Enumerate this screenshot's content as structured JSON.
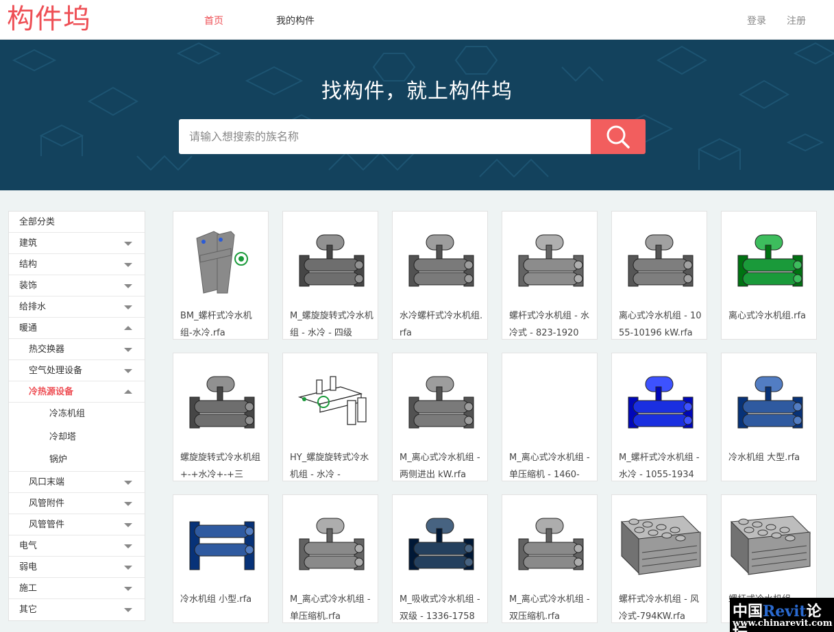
{
  "header": {
    "logo": "构件坞",
    "nav": [
      {
        "label": "首页",
        "active": true
      },
      {
        "label": "我的构件",
        "active": false
      }
    ],
    "login": "登录",
    "register": "注册"
  },
  "banner": {
    "title": "找构件，就上构件坞",
    "search_placeholder": "请输入想搜索的族名称",
    "search_icon": "search-icon"
  },
  "sidebar": {
    "all": "全部分类",
    "items": [
      {
        "label": "建筑",
        "level": 1,
        "caret": "down"
      },
      {
        "label": "结构",
        "level": 1,
        "caret": "down"
      },
      {
        "label": "装饰",
        "level": 1,
        "caret": "down"
      },
      {
        "label": "给排水",
        "level": 1,
        "caret": "down"
      },
      {
        "label": "暖通",
        "level": 1,
        "caret": "up"
      },
      {
        "label": "热交换器",
        "level": 2,
        "caret": "down"
      },
      {
        "label": "空气处理设备",
        "level": 2,
        "caret": "down"
      },
      {
        "label": "冷热源设备",
        "level": 2,
        "caret": "up",
        "active": true
      },
      {
        "label": "冷冻机组",
        "level": 3
      },
      {
        "label": "冷却塔",
        "level": 3
      },
      {
        "label": "锅炉",
        "level": 3
      },
      {
        "label": "风口末端",
        "level": 2,
        "caret": "down"
      },
      {
        "label": "风管附件",
        "level": 2,
        "caret": "down"
      },
      {
        "label": "风管管件",
        "level": 2,
        "caret": "down"
      },
      {
        "label": "电气",
        "level": 1,
        "caret": "down"
      },
      {
        "label": "弱电",
        "level": 1,
        "caret": "down"
      },
      {
        "label": "施工",
        "level": 1,
        "caret": "down"
      },
      {
        "label": "其它",
        "level": 1,
        "caret": "down"
      }
    ]
  },
  "cards": [
    {
      "name": "BM_螺杆式冷水机组-水冷.rfa",
      "color": "#8a8a8a",
      "style": "frame"
    },
    {
      "name": "M_螺旋旋转式冷水机组 - 水冷 - 四级",
      "color": "#6e6e6e",
      "style": "chiller"
    },
    {
      "name": "水冷螺杆式冷水机组.rfa",
      "color": "#7a7a7a",
      "style": "chiller"
    },
    {
      "name": "螺杆式冷水机组 - 水冷式 - 823-1920",
      "color": "#8c8c8c",
      "style": "chiller"
    },
    {
      "name": "离心式冷水机组 - 1055-10196 kW.rfa",
      "color": "#7e7e7e",
      "style": "chiller"
    },
    {
      "name": "离心式冷水机组.rfa",
      "color": "#1a9a3a",
      "style": "chiller"
    },
    {
      "name": "螺旋旋转式冷水机组+-+水冷+-+三",
      "color": "#6e6e6e",
      "style": "chiller"
    },
    {
      "name": "HY_螺旋旋转式冷水机组 - 水冷 -",
      "color": "#ffffff",
      "style": "wire"
    },
    {
      "name": "M_离心式冷水机组 - 两侧进出 kW.rfa",
      "color": "#7a7a7a",
      "style": "chiller"
    },
    {
      "name": "M_离心式冷水机组 - 单压缩机 - 1460-",
      "color": "#ffffff",
      "style": "empty"
    },
    {
      "name": "M_螺杆式冷水机组 - 水冷 - 1055-1934",
      "color": "#1a2fe0",
      "style": "chiller"
    },
    {
      "name": "冷水机组 大型.rfa",
      "color": "#2f5aa0",
      "style": "chiller"
    },
    {
      "name": "冷水机组 小型.rfa",
      "color": "#2f5aa0",
      "style": "small"
    },
    {
      "name": "M_离心式冷水机组 - 单压缩机.rfa",
      "color": "#8a8a8a",
      "style": "chiller"
    },
    {
      "name": "M_吸收式冷水机组 - 双级 - 1336-1758",
      "color": "#24405e",
      "style": "chiller"
    },
    {
      "name": "M_离心式冷水机组 - 双压缩机.rfa",
      "color": "#8a8a8a",
      "style": "chiller"
    },
    {
      "name": "螺杆式冷水机组 - 风冷式-794KW.rfa",
      "color": "#9a9a9a",
      "style": "aircooled"
    },
    {
      "name": "螺杆式冷水机组",
      "color": "#9a9a9a",
      "style": "aircooled"
    }
  ],
  "watermark": {
    "line1_a": "中国",
    "line1_b": "Revit",
    "line1_c": "论坛",
    "line2": "www.chinarevit.com"
  }
}
